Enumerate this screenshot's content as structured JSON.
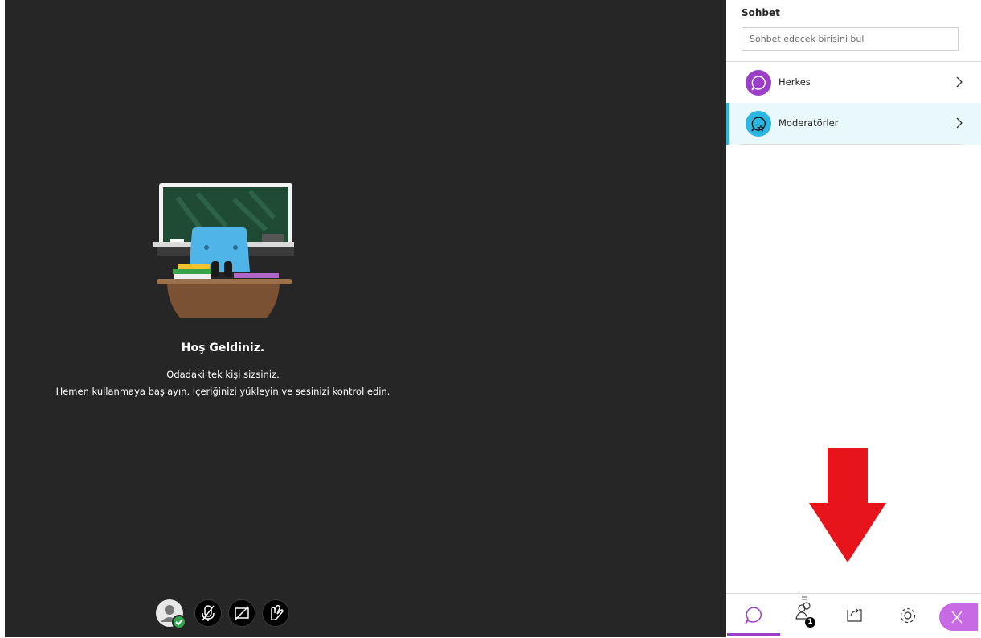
{
  "welcome": {
    "title": "Hoş Geldiniz.",
    "line1": "Odadaki tek kişi sizsiniz.",
    "line2": "Hemen kullanmaya başlayın. İçeriğinizi yükleyin ve sesinizi kontrol edin."
  },
  "controls": [
    "avatar-icon",
    "mic-off-icon",
    "camera-off-icon",
    "raise-hand-icon"
  ],
  "chat_panel": {
    "title": "Sohbet",
    "search_placeholder": "Sohbet edecek birisini bul",
    "channels": [
      {
        "label": "Herkes",
        "color": "#9b3fc6"
      },
      {
        "label": "Moderatörler",
        "color": "#2bb5e0"
      }
    ]
  },
  "tabs": {
    "attendee_badge": "1",
    "accent": "#9b3fc6",
    "close_color": "#c86ae3"
  },
  "annotation_arrow_color": "#e8141c"
}
